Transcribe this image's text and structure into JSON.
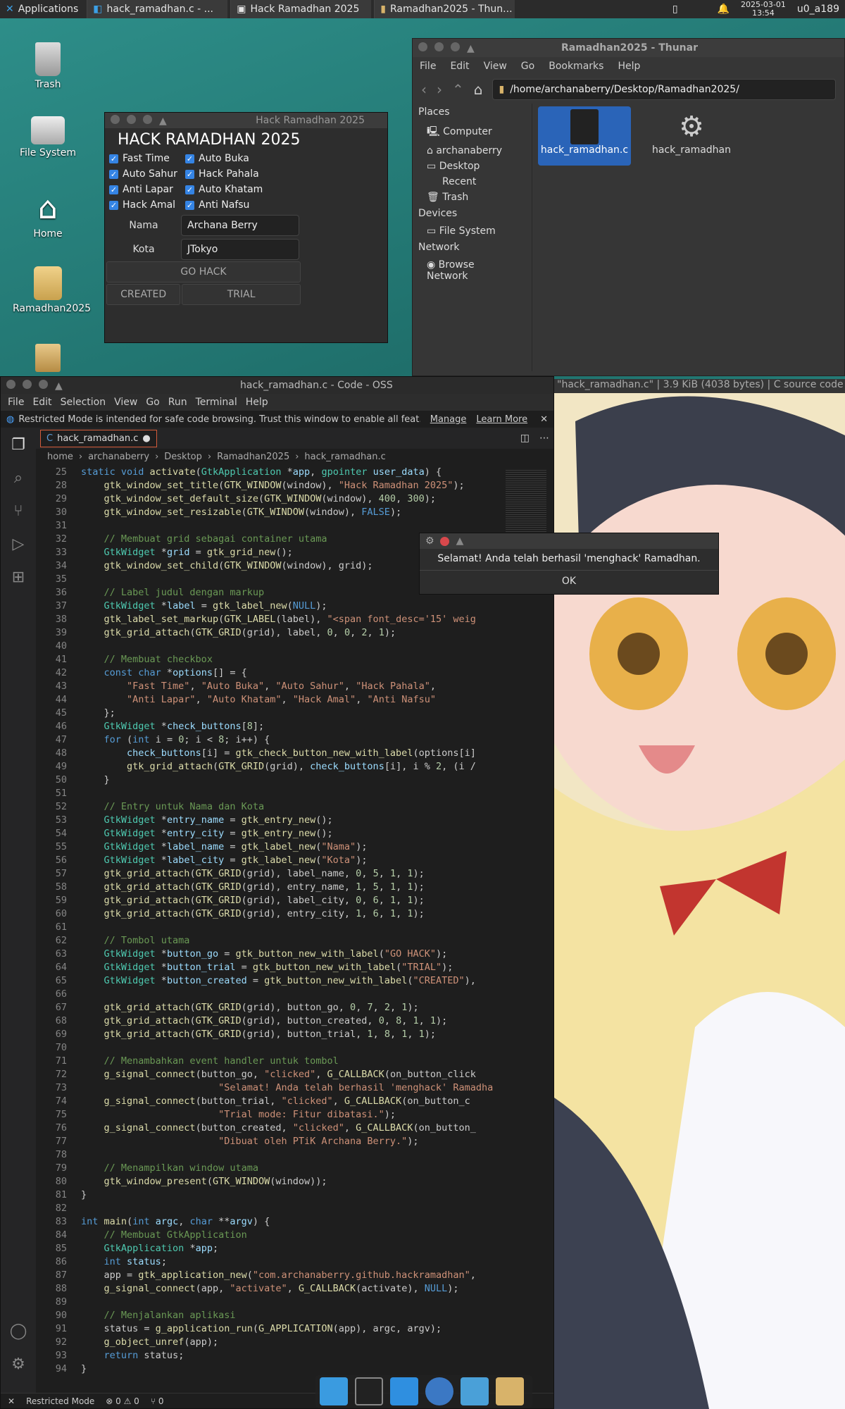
{
  "panel": {
    "apps_label": "Applications",
    "tasks": [
      "hack_ramadhan.c - ...",
      "Hack Ramadhan 2025",
      "Ramadhan2025 - Thun..."
    ],
    "date": "2025-03-01",
    "time": "13:54",
    "user": "u0_a189"
  },
  "desktop": {
    "icons": [
      "Trash",
      "File System",
      "Home",
      "Ramadhan2025"
    ]
  },
  "thunar": {
    "title": "Ramadhan2025 - Thunar",
    "menu": [
      "File",
      "Edit",
      "View",
      "Go",
      "Bookmarks",
      "Help"
    ],
    "path": "/home/archanaberry/Desktop/Ramadhan2025/",
    "places_header": "Places",
    "places": [
      "Computer",
      "archanaberry",
      "Desktop",
      "Recent",
      "Trash"
    ],
    "devices_header": "Devices",
    "devices": [
      "File System"
    ],
    "network_header": "Network",
    "network": [
      "Browse Network"
    ],
    "files": [
      "hack_ramadhan.c",
      "hack_ramadhan"
    ],
    "status": "\"hack_ramadhan.c\"  |  3.9 KiB (4038 bytes)  |  C source code"
  },
  "gtk": {
    "title": "Hack Ramadhan 2025",
    "heading": "HACK RAMADHAN 2025",
    "options": [
      "Fast Time",
      "Auto Buka",
      "Auto Sahur",
      "Hack Pahala",
      "Anti Lapar",
      "Auto Khatam",
      "Hack Amal",
      "Anti Nafsu"
    ],
    "name_label": "Nama",
    "name_value": "Archana Berry",
    "city_label": "Kota",
    "city_value": "JTokyo",
    "go_button": "GO HACK",
    "created_button": "CREATED",
    "trial_button": "TRIAL"
  },
  "code": {
    "title": "hack_ramadhan.c - Code - OSS",
    "menu": [
      "File",
      "Edit",
      "Selection",
      "View",
      "Go",
      "Run",
      "Terminal",
      "Help"
    ],
    "banner": "Restricted Mode is intended for safe code browsing. Trust this window to enable all feat...",
    "banner_manage": "Manage",
    "banner_learn": "Learn More",
    "tab": "hack_ramadhan.c",
    "breadcrumb": [
      "home",
      "archanaberry",
      "Desktop",
      "Ramadhan2025",
      "hack_ramadhan.c"
    ],
    "status_mode": "Restricted Mode",
    "status_problems": "⊗ 0 ⚠ 0",
    "status_ports": "⑂ 0"
  },
  "dialog": {
    "message": "Selamat! Anda telah berhasil 'menghack' Ramadhan.",
    "ok": "OK"
  },
  "colors": {
    "accent": "#3584e4",
    "panel": "#2b2b2b",
    "editor_bg": "#1e1e1e"
  }
}
